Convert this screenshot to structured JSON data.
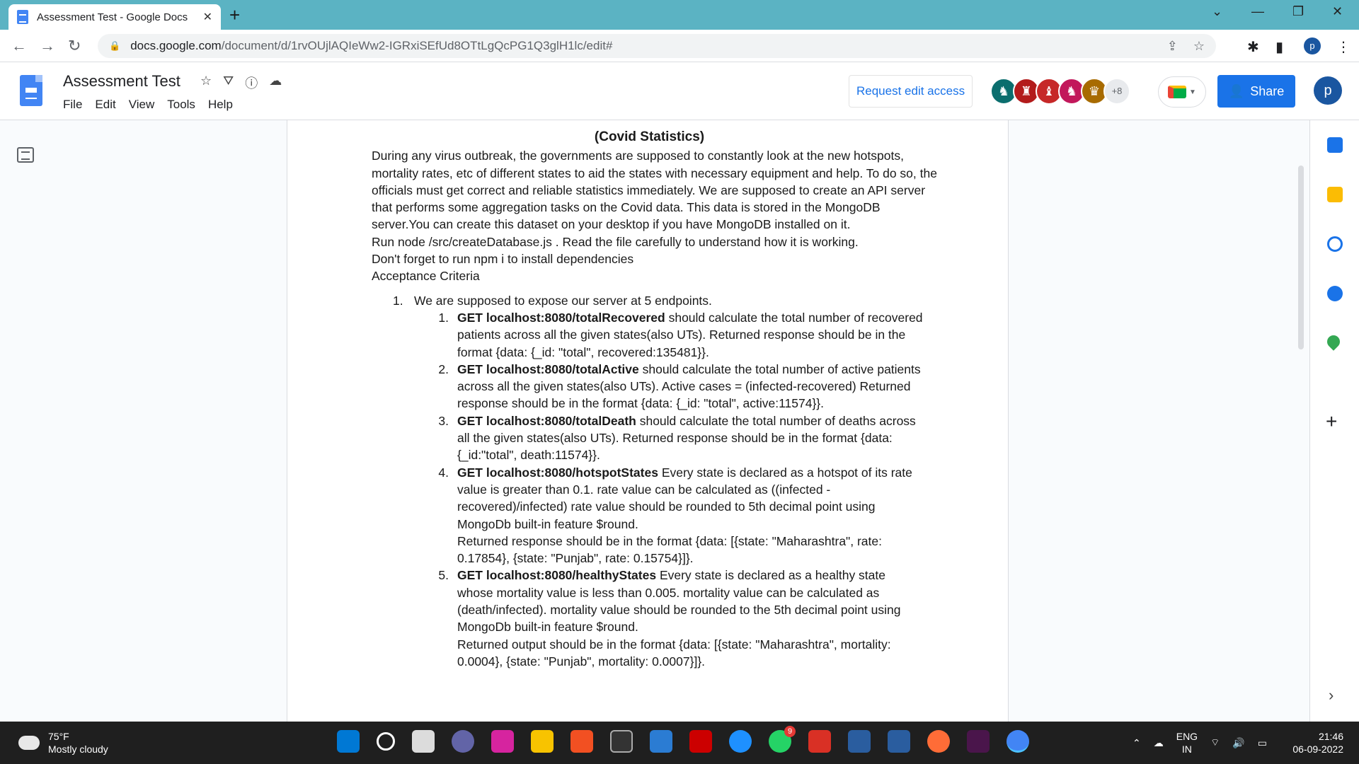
{
  "browser": {
    "tab_title": "Assessment Test - Google Docs",
    "tab_close": "✕",
    "new_tab": "+",
    "url_domain": "docs.google.com",
    "url_path": "/document/d/1rvOUjlAQIeWw2-IGRxiSEfUd8OTtLgQcPG1Q3glH1lc/edit#",
    "profile_initial": "p"
  },
  "docs": {
    "title": "Assessment Test",
    "menu": [
      "File",
      "Edit",
      "View",
      "Tools",
      "Help"
    ],
    "request_edit": "Request edit access",
    "more_collaborators": "+8",
    "share_label": "Share",
    "profile_initial": "p"
  },
  "document": {
    "heading": "(Covid Statistics)",
    "paragraphs": [
      "During any virus outbreak, the governments are supposed to constantly look at the new hotspots, mortality rates, etc of different states to aid the states with necessary equipment and help. To do so, the officials must get correct and reliable statistics immediately. We are supposed to create an API server that performs some aggregation tasks on the Covid data. This data is stored in the MongoDB server.You can create this dataset on your desktop if you have MongoDB installed on it.",
      "Run node /src/createDatabase.js . Read the file carefully to understand how it is working.",
      "Don't forget to run npm i to install dependencies",
      "Acceptance Criteria"
    ],
    "list_item_1": {
      "num": "1.",
      "text": "We are supposed to expose our server at 5 endpoints."
    },
    "endpoints": [
      {
        "num": "1.",
        "endpoint": "GET localhost:8080/totalRecovered",
        "text": " should calculate the total number of recovered patients across all the given states(also UTs). Returned response should be in the format {data: {_id: \"total\", recovered:135481}}."
      },
      {
        "num": "2.",
        "endpoint": "GET localhost:8080/totalActive",
        "text": " should calculate the total number of active patients across all the given states(also UTs). Active cases = (infected-recovered) Returned response should be in the format {data: {_id: \"total\", active:11574}}."
      },
      {
        "num": "3.",
        "endpoint": "GET localhost:8080/totalDeath",
        "text": " should calculate the total number of deaths across all the given states(also UTs). Returned response should be in the format {data: {_id:\"total\", death:11574}}."
      },
      {
        "num": "4.",
        "endpoint": "GET localhost:8080/hotspotStates",
        "text": " Every state is declared as a hotspot of its rate value is greater than 0.1. rate value can be calculated as ((infected - recovered)/infected) rate value should be rounded to 5th decimal point using MongoDb built-in feature $round.",
        "extra": "Returned response should be in the format {data: [{state: \"Maharashtra\", rate: 0.17854}, {state: \"Punjab\", rate: 0.15754}]}."
      },
      {
        "num": "5.",
        "endpoint": "GET localhost:8080/healthyStates",
        "text": " Every state is declared as a healthy state whose mortality value is less than 0.005. mortality value can be calculated as (death/infected). mortality value should be rounded to the 5th decimal point using MongoDb built-in feature $round.",
        "extra": "Returned output should be in the format {data: [{state: \"Maharashtra\", mortality: 0.0004}, {state: \"Punjab\", mortality: 0.0007}]}."
      }
    ]
  },
  "taskbar": {
    "temperature": "75°F",
    "weather": "Mostly cloudy",
    "lang_top": "ENG",
    "lang_bottom": "IN",
    "time": "21:46",
    "date": "06-09-2022",
    "whatsapp_badge": "9"
  }
}
